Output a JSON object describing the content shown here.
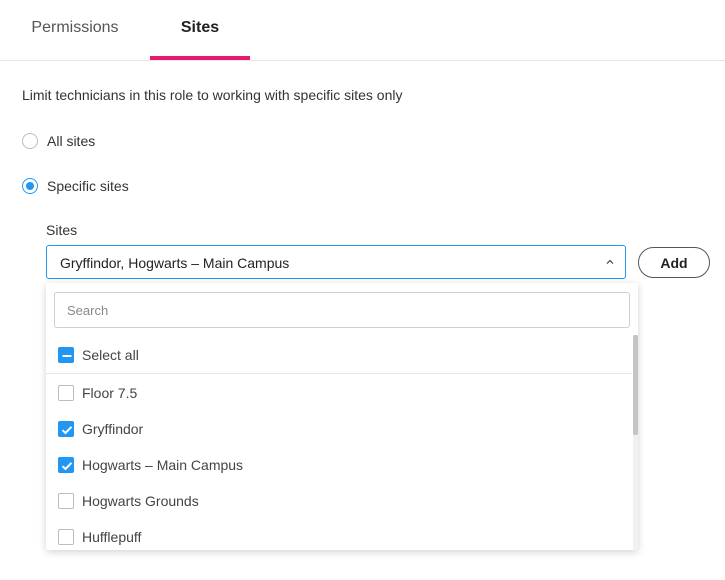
{
  "tabs": [
    {
      "label": "Permissions",
      "active": false
    },
    {
      "label": "Sites",
      "active": true
    }
  ],
  "accent_color": "#e5196d",
  "primary_color": "#2196f3",
  "description": "Limit technicians in this role to working with specific sites only",
  "scope": {
    "options": [
      {
        "label": "All sites",
        "selected": false
      },
      {
        "label": "Specific sites",
        "selected": true
      }
    ]
  },
  "sites_field": {
    "label": "Sites",
    "value": "Gryffindor, Hogwarts – Main Campus",
    "expanded": true
  },
  "add_button": {
    "label": "Add"
  },
  "dropdown": {
    "search_placeholder": "Search",
    "select_all": {
      "label": "Select all",
      "state": "indeterminate"
    },
    "items": [
      {
        "label": "Floor 7.5",
        "checked": false
      },
      {
        "label": "Gryffindor",
        "checked": true
      },
      {
        "label": "Hogwarts – Main Campus",
        "checked": true
      },
      {
        "label": "Hogwarts Grounds",
        "checked": false
      },
      {
        "label": "Hufflepuff",
        "checked": false
      }
    ]
  }
}
